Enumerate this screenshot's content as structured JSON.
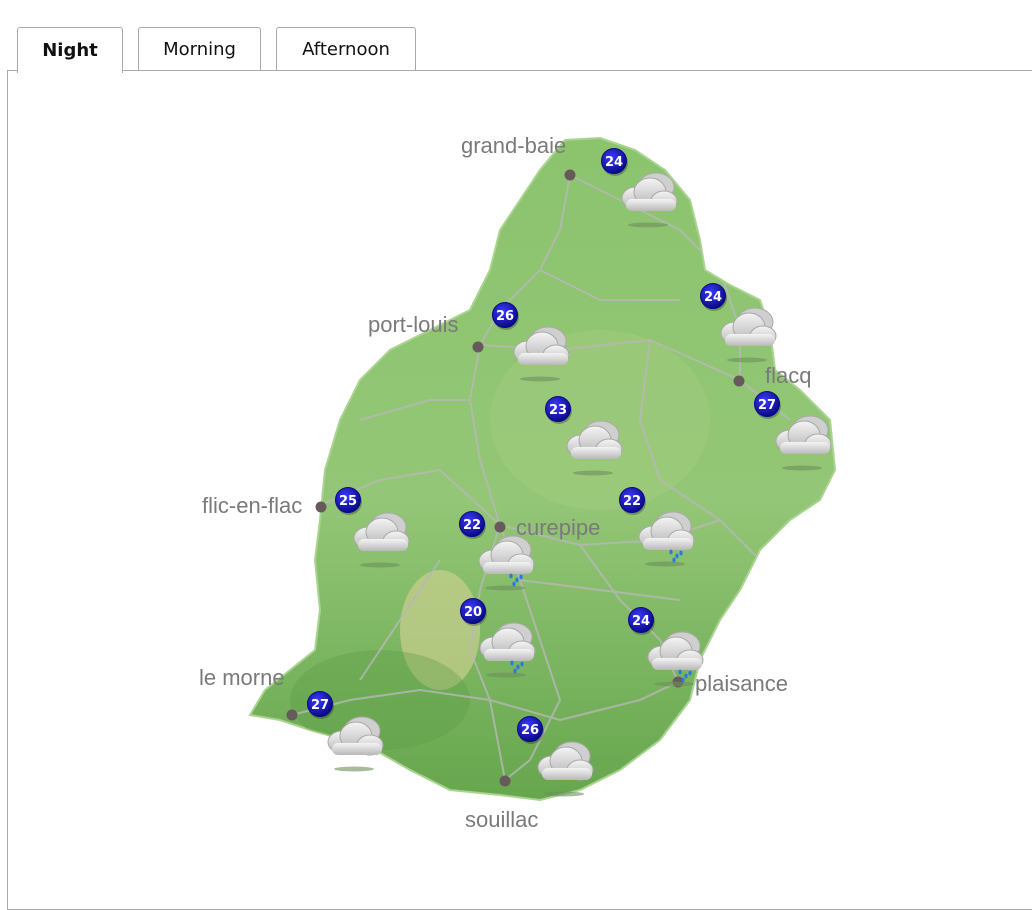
{
  "tabs": [
    {
      "label": "Night",
      "active": true
    },
    {
      "label": "Morning",
      "active": false
    },
    {
      "label": "Afternoon",
      "active": false
    }
  ],
  "map": {
    "places": [
      {
        "name": "grand-baie"
      },
      {
        "name": "port-louis"
      },
      {
        "name": "flacq"
      },
      {
        "name": "flic-en-flac"
      },
      {
        "name": "curepipe"
      },
      {
        "name": "le morne"
      },
      {
        "name": "plaisance"
      },
      {
        "name": "souillac"
      }
    ],
    "forecasts": [
      {
        "temp": "24",
        "icon": "cloudy-icon"
      },
      {
        "temp": "26",
        "icon": "cloudy-icon"
      },
      {
        "temp": "24",
        "icon": "cloudy-icon"
      },
      {
        "temp": "23",
        "icon": "cloudy-icon"
      },
      {
        "temp": "27",
        "icon": "cloudy-icon"
      },
      {
        "temp": "25",
        "icon": "cloudy-icon"
      },
      {
        "temp": "22",
        "icon": "light-rain-icon"
      },
      {
        "temp": "22",
        "icon": "light-rain-icon"
      },
      {
        "temp": "20",
        "icon": "light-rain-icon"
      },
      {
        "temp": "24",
        "icon": "light-rain-icon"
      },
      {
        "temp": "27",
        "icon": "cloudy-icon"
      },
      {
        "temp": "26",
        "icon": "cloudy-icon"
      }
    ],
    "colors": {
      "land": "#8cc46e",
      "land_south": "#6fae55",
      "roads": "#bcbcbc",
      "badge": "#1010b8",
      "town_dot": "#665a5a"
    }
  }
}
